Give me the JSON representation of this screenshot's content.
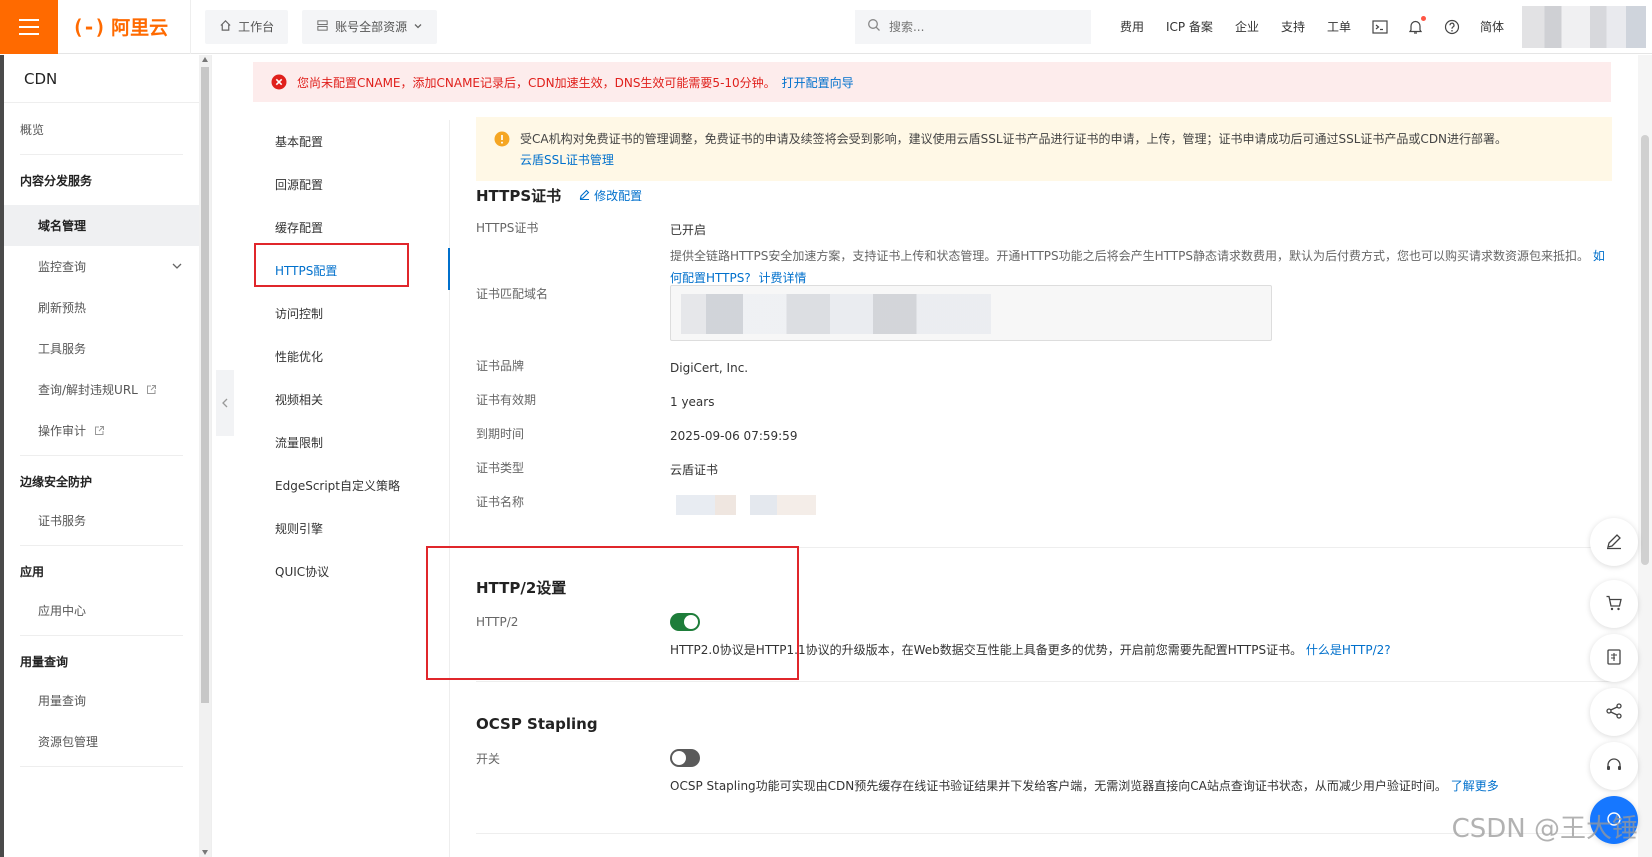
{
  "header": {
    "logo_text": "阿里云",
    "workbench": "工作台",
    "resource_select": "账号全部资源",
    "search_placeholder": "搜索...",
    "nav": [
      "费用",
      "ICP 备案",
      "企业",
      "支持",
      "工单"
    ],
    "lang": "简体"
  },
  "sidebar": {
    "title": "CDN",
    "overview": "概览",
    "groups": [
      {
        "title": "内容分发服务",
        "items": [
          "域名管理",
          "监控查询",
          "刷新预热",
          "工具服务",
          "查询/解封违规URL",
          "操作审计"
        ]
      },
      {
        "title": "边缘安全防护",
        "items": [
          "证书服务"
        ]
      },
      {
        "title": "应用",
        "items": [
          "应用中心"
        ]
      },
      {
        "title": "用量查询",
        "items": [
          "用量查询",
          "资源包管理"
        ]
      }
    ]
  },
  "alert": {
    "text": "您尚未配置CNAME，添加CNAME记录后，CDN加速生效，DNS生效可能需要5-10分钟。",
    "link": "打开配置向导"
  },
  "subnav": [
    "基本配置",
    "回源配置",
    "缓存配置",
    "HTTPS配置",
    "访问控制",
    "性能优化",
    "视频相关",
    "流量限制",
    "EdgeScript自定义策略",
    "规则引擎",
    "QUIC协议"
  ],
  "notice": {
    "text": "受CA机构对免费证书的管理调整，免费证书的申请及续签将会受到影响，建议使用云盾SSL证书产品进行证书的申请，上传，管理；证书申请成功后可通过SSL证书产品或CDN进行部署。",
    "link": "云盾SSL证书管理"
  },
  "https": {
    "title": "HTTPS证书",
    "edit": "修改配置",
    "rows": {
      "cert_label": "HTTPS证书",
      "cert_status": "已开启",
      "cert_desc": "提供全链路HTTPS安全加速方案，支持证书上传和状态管理。开通HTTPS功能之后将会产生HTTPS静态请求数费用，默认为后付费方式，您也可以购买请求数资源包来抵扣。",
      "cert_link1": "如何配置HTTPS?",
      "cert_link2": "计费详情",
      "domain_label": "证书匹配域名",
      "brand_label": "证书品牌",
      "brand": "DigiCert, Inc.",
      "validity_label": "证书有效期",
      "validity": "1 years",
      "expire_label": "到期时间",
      "expire": "2025-09-06 07:59:59",
      "type_label": "证书类型",
      "type": "云盾证书",
      "name_label": "证书名称"
    }
  },
  "http2": {
    "title": "HTTP/2设置",
    "label": "HTTP/2",
    "desc": "HTTP2.0协议是HTTP1.1协议的升级版本，在Web数据交互性能上具备更多的优势，开启前您需要先配置HTTPS证书。",
    "link": "什么是HTTP/2?"
  },
  "ocsp": {
    "title": "OCSP Stapling",
    "label": "开关",
    "desc": "OCSP Stapling功能可实现由CDN预先缓存在线证书验证结果并下发给客户端，无需浏览器直接向CA站点查询证书状态，从而减少用户验证时间。",
    "link": "了解更多"
  },
  "watermark": "CSDN @王大锤",
  "colors": {
    "brand": "#ff6a00",
    "link": "#0070cc",
    "error": "#e0201c",
    "toggle_on": "#1e7d3a",
    "highlight_box": "#e0262b"
  }
}
